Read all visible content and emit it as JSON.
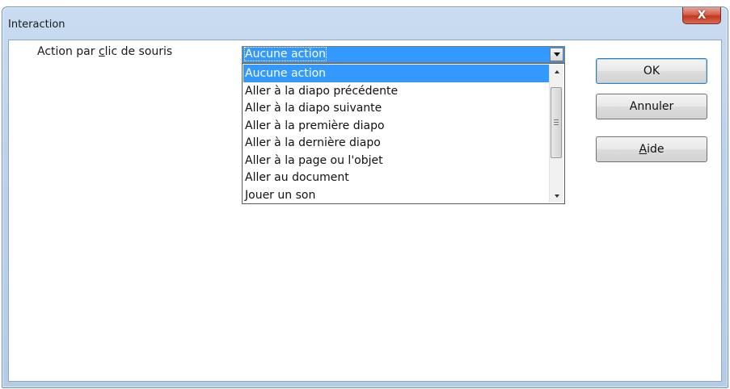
{
  "window": {
    "title": "Interaction",
    "close_label": "X"
  },
  "form": {
    "label_prefix": "Action par ",
    "label_accel": "c",
    "label_suffix": "lic de souris",
    "selected_value": "Aucune action"
  },
  "dropdown": {
    "options": [
      "Aucune action",
      "Aller à la diapo précédente",
      "Aller à la diapo suivante",
      "Aller à la première diapo",
      "Aller à la dernière diapo",
      "Aller à la page ou l'objet",
      "Aller au document",
      "Jouer un son"
    ],
    "highlighted_index": 0
  },
  "buttons": {
    "ok_label": "OK",
    "cancel_label": "Annuler",
    "help_accel": "A",
    "help_rest": "ide"
  },
  "colors": {
    "selection": "#3399ff",
    "close": "#c4371f"
  }
}
